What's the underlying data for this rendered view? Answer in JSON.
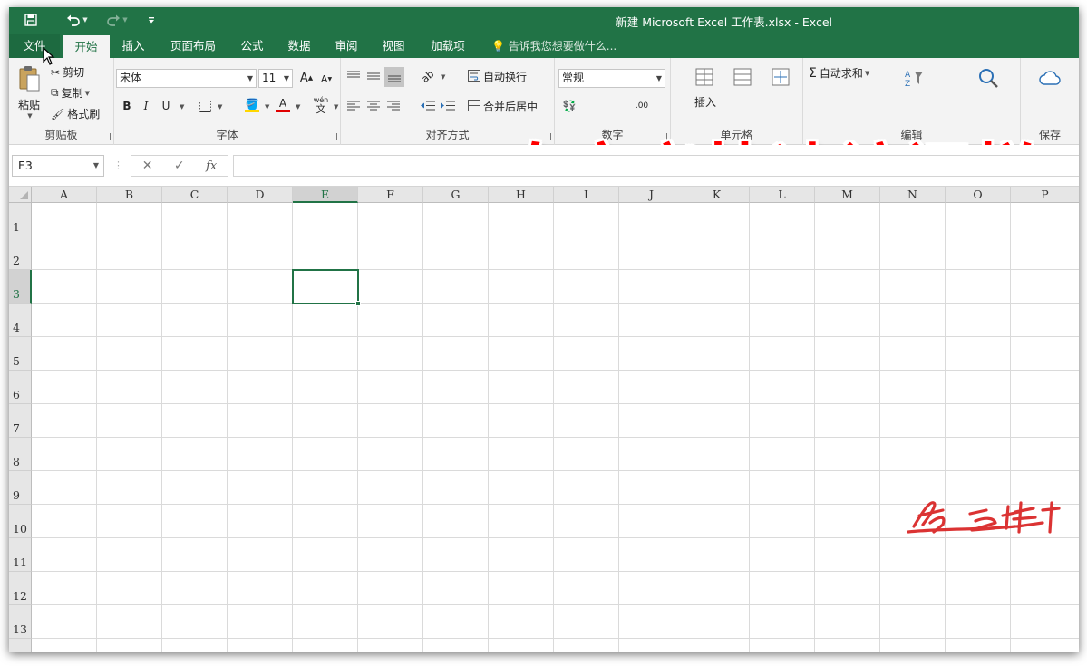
{
  "window": {
    "title": "新建 Microsoft Excel 工作表.xlsx - Excel",
    "accent_color": "#217346"
  },
  "quick_access": {
    "save_icon": "save-icon",
    "undo_icon": "undo-icon",
    "redo_icon": "redo-icon",
    "customize_icon": "customize-qat-icon"
  },
  "tabs": [
    {
      "label": "文件"
    },
    {
      "label": "开始"
    },
    {
      "label": "插入"
    },
    {
      "label": "页面布局"
    },
    {
      "label": "公式"
    },
    {
      "label": "数据"
    },
    {
      "label": "审阅"
    },
    {
      "label": "视图"
    },
    {
      "label": "加载项"
    }
  ],
  "active_tab": "开始",
  "tell_me": "告诉我您想要做什么...",
  "ribbon": {
    "clipboard": {
      "paste": "粘贴",
      "cut": "剪切",
      "copy": "复制",
      "format_painter": "格式刷",
      "label": "剪贴板"
    },
    "font": {
      "font_name": "宋体",
      "font_size": "11",
      "bold": "B",
      "italic": "I",
      "underline": "U",
      "phonetic": "wén",
      "phonetic_sub": "文",
      "label": "字体"
    },
    "alignment": {
      "wrap_text": "自动换行",
      "merge_center": "合并后居中",
      "label": "对齐方式"
    },
    "number": {
      "format": "常规",
      "label": "数字"
    },
    "cells": {
      "insert": "插入",
      "label": "单元格"
    },
    "editing": {
      "autosum": "自动求和",
      "label": "编辑"
    },
    "share": {
      "label": "保存"
    }
  },
  "overlay_title": "自定义快速访问栏",
  "formula_bar": {
    "name_box": "E3",
    "cancel": "✕",
    "enter": "✓",
    "fx": "fx",
    "content": ""
  },
  "grid": {
    "columns": [
      "A",
      "B",
      "C",
      "D",
      "E",
      "F",
      "G",
      "H",
      "I",
      "J",
      "K",
      "L",
      "M",
      "N",
      "O",
      "P"
    ],
    "rows": [
      "1",
      "2",
      "3",
      "4",
      "5",
      "6",
      "7",
      "8",
      "9",
      "10",
      "11",
      "12",
      "13"
    ],
    "selected_cell": "E3",
    "selected_column": "E",
    "selected_row": "3"
  }
}
